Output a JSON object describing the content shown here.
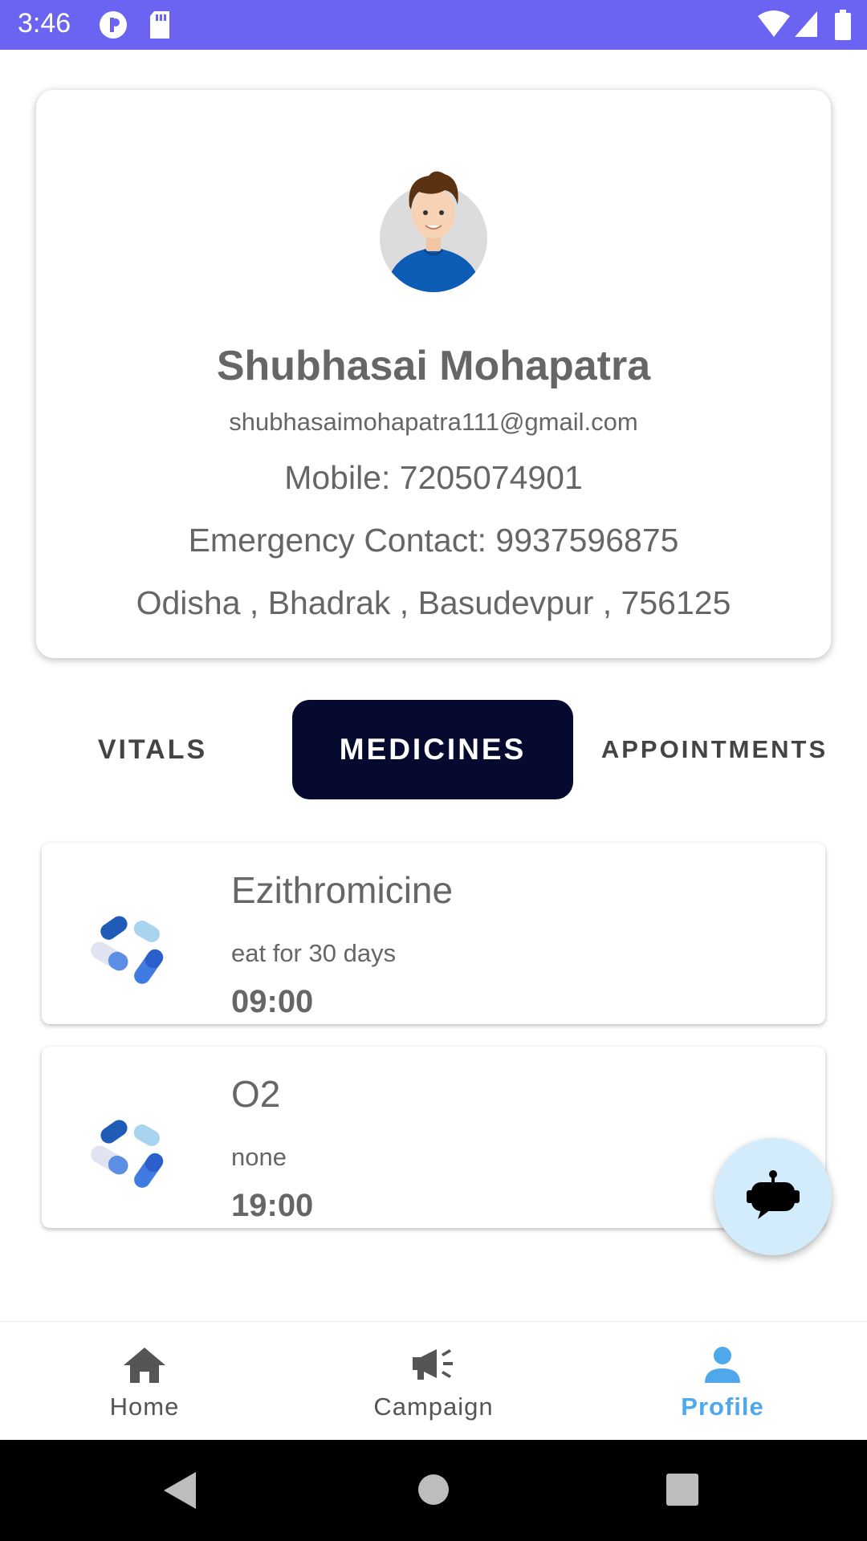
{
  "status_bar": {
    "time": "3:46",
    "icons": [
      "pinterest-like-icon",
      "sd-card-icon",
      "wifi-icon",
      "signal-icon",
      "battery-icon"
    ],
    "background_color": "#6b63f2"
  },
  "profile": {
    "name": "Shubhasai Mohapatra",
    "email": "shubhasaimohapatra111@gmail.com",
    "mobile": "Mobile: 7205074901",
    "emergency_contact": "Emergency Contact: 9937596875",
    "address": "Odisha , Bhadrak , Basudevpur , 756125"
  },
  "tabs": [
    {
      "label": "VITALS",
      "selected": false
    },
    {
      "label": "MEDICINES",
      "selected": true
    },
    {
      "label": "APPOINTMENTS",
      "selected": false
    }
  ],
  "medicines": [
    {
      "name": "Ezithromicine",
      "note": "eat for 30 days",
      "time": "09:00",
      "icon": "pills-icon"
    },
    {
      "name": "O2",
      "note": "none",
      "time": "19:00",
      "icon": "pills-icon"
    }
  ],
  "fab": {
    "icon": "chatbot-icon",
    "color": "#d3ecfb"
  },
  "bottom_nav": [
    {
      "label": "Home",
      "icon": "home-icon",
      "active": false
    },
    {
      "label": "Campaign",
      "icon": "megaphone-icon",
      "active": false
    },
    {
      "label": "Profile",
      "icon": "person-icon",
      "active": true
    }
  ],
  "colors": {
    "accent": "#4fa7ec",
    "selected_tab": "#050a2e"
  }
}
